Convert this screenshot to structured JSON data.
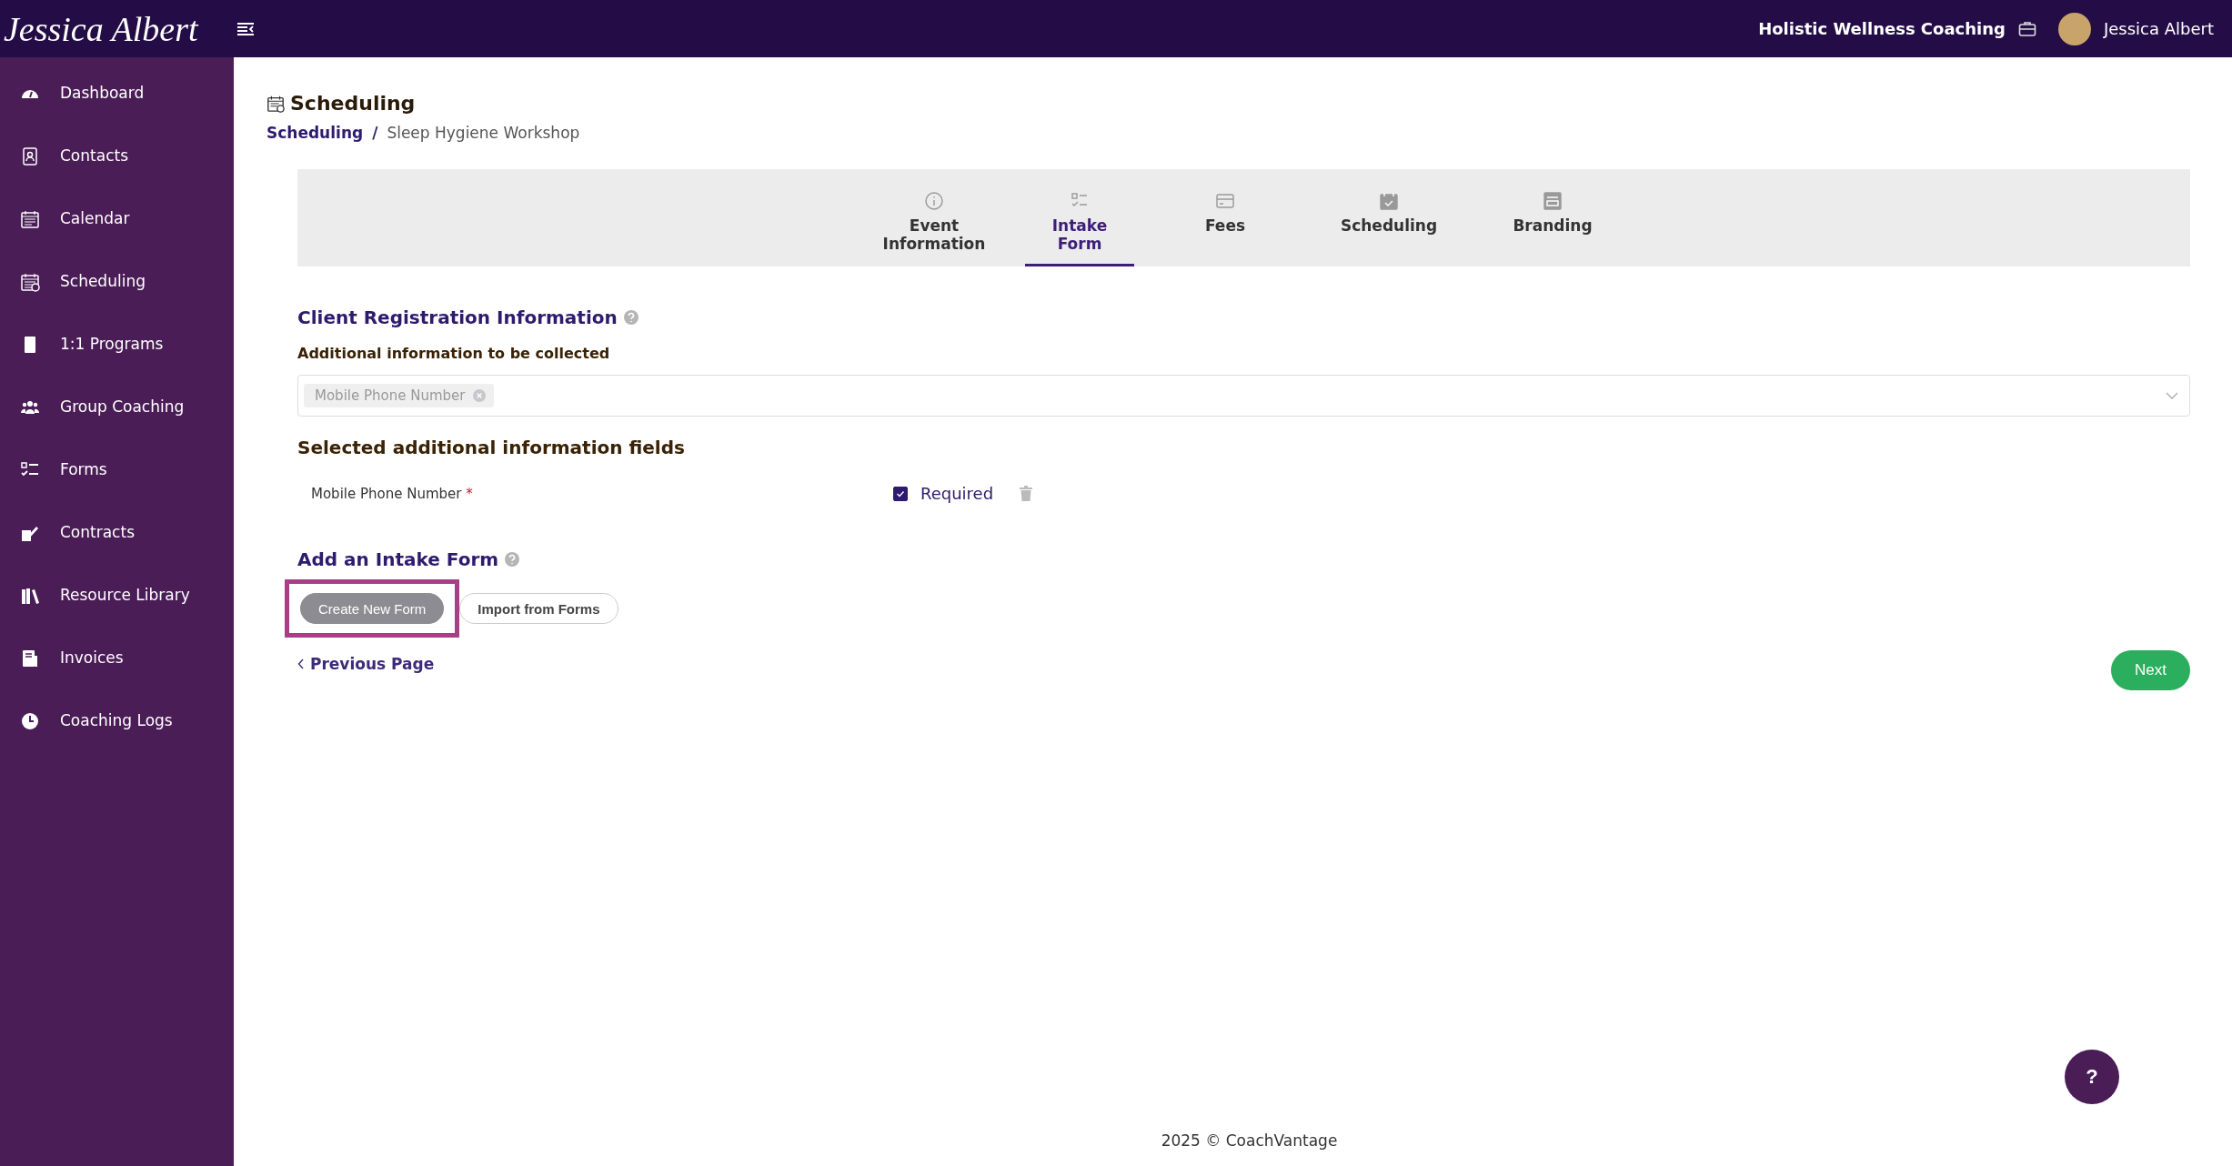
{
  "topbar": {
    "logo": "Jessica Albert",
    "business": "Holistic Wellness Coaching",
    "user": "Jessica Albert"
  },
  "sidebar": {
    "items": [
      {
        "label": "Dashboard",
        "selected": false
      },
      {
        "label": "Contacts",
        "selected": false
      },
      {
        "label": "Calendar",
        "selected": false
      },
      {
        "label": "Scheduling",
        "selected": false
      },
      {
        "label": "1:1 Programs",
        "selected": false
      },
      {
        "label": "Group Coaching",
        "selected": false
      },
      {
        "label": "Forms",
        "selected": false
      },
      {
        "label": "Contracts",
        "selected": false
      },
      {
        "label": "Resource Library",
        "selected": false
      },
      {
        "label": "Invoices",
        "selected": false
      },
      {
        "label": "Coaching Logs",
        "selected": false
      }
    ]
  },
  "page": {
    "title": "Scheduling",
    "separator": "/",
    "breadcrumb": [
      {
        "label": "Scheduling",
        "kind": "link"
      },
      {
        "label": "Sleep Hygiene Workshop",
        "kind": "current"
      }
    ]
  },
  "steps": [
    {
      "label": "Event Information",
      "selected": false
    },
    {
      "label": "Intake Form",
      "selected": true
    },
    {
      "label": "Fees",
      "selected": false
    },
    {
      "label": "Scheduling",
      "selected": false
    },
    {
      "label": "Branding",
      "selected": false
    }
  ],
  "registration": {
    "heading": "Client Registration Information",
    "label": "Additional information to be collected",
    "tags": [
      "Mobile Phone Number"
    ],
    "selected_heading": "Selected additional information fields",
    "fields": [
      {
        "name": "Mobile Phone Number",
        "required_mark": "*",
        "required_label": "Required",
        "checked": true
      }
    ]
  },
  "intake": {
    "heading": "Add an Intake Form",
    "buttons": [
      {
        "label": "Create New Form",
        "kind": "filled",
        "highlighted": true
      },
      {
        "label": "Import from Forms",
        "kind": "outline",
        "highlighted": false
      }
    ]
  },
  "nav": {
    "previous": "Previous Page",
    "next": "Next"
  },
  "help": "?",
  "footer": "2025 © CoachVantage"
}
